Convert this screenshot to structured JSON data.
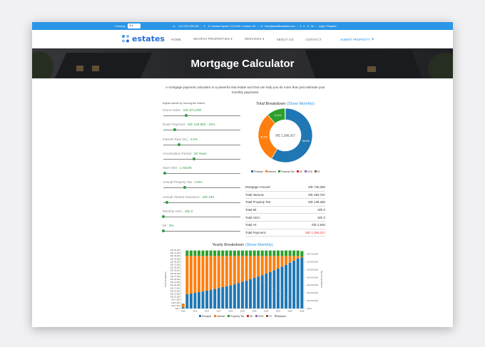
{
  "topbar": {
    "currency_label": "Currency",
    "currency_value": "$",
    "phone": "+44 7073 258 326",
    "address": "11 Canada Square, E14 5HX, London, UK",
    "email": "hello@startfiloestates.com",
    "login": "Login / Register"
  },
  "nav": {
    "logo": "estates",
    "items": [
      "HOME",
      "SEARCH PROPERTIES ▾",
      "SERVICES ▾",
      "ABOUT US",
      "CONTACT"
    ],
    "submit": "SUBMIT PROPERTY"
  },
  "hero": {
    "title": "Mortgage Calculator"
  },
  "intro": "A mortgage payment calculator is a powerful real estate tool that can help you do more than just estimate your monthly payments.",
  "sliders": {
    "heading": "Adjust values by moving the sliders",
    "items": [
      {
        "label": "Home Value",
        "value": "S/E 871,000",
        "level": 0.3
      },
      {
        "label": "Down Payment",
        "value": "S/E 130,650 - 15%",
        "level": 0.15
      },
      {
        "label": "Interest Rate (%)",
        "value": "4.5%",
        "level": 0.2
      },
      {
        "label": "Amortization Period",
        "value": "30 Years",
        "level": 0.4
      },
      {
        "label": "Start After",
        "value": "1 Month",
        "level": 0.02
      },
      {
        "label": "Annual Property Tax",
        "value": "0.8%",
        "level": 0.28
      },
      {
        "label": "Annual Hazard Insurance",
        "value": "S/E 240",
        "level": 0.05
      },
      {
        "label": "Monthly HOA",
        "value": "S/E 0",
        "level": 0.0
      },
      {
        "label": "MI",
        "value": "0%",
        "level": 0.0
      }
    ]
  },
  "total_breakdown": {
    "title": "Total Breakdown",
    "toggle": "(Show Monthly)",
    "center": "S/E 1,266,317",
    "slices": [
      {
        "name": "Principal",
        "pct": 58.5,
        "color": "#1f77b4",
        "label": "58.5%"
      },
      {
        "name": "Interest",
        "pct": 30.3,
        "color": "#ff7f0e",
        "label": "30.3%"
      },
      {
        "name": "Property Tax",
        "pct": 11.0,
        "color": "#2ca02c",
        "label": "11.0%"
      },
      {
        "name": "MI",
        "pct": 0.1,
        "color": "#d62728",
        "label": ""
      },
      {
        "name": "HOA",
        "pct": 0.05,
        "color": "#9467bd",
        "label": ""
      },
      {
        "name": "HI",
        "pct": 0.05,
        "color": "#8c564b",
        "label": ""
      }
    ],
    "legend": [
      "Principal",
      "Interest",
      "Property Tax",
      "MI",
      "HOA",
      "HI"
    ]
  },
  "summary": [
    {
      "label": "Mortgage Amount:",
      "value": "S/E 740,350"
    },
    {
      "label": "Total Interest:",
      "value": "S/E 383,767"
    },
    {
      "label": "Total Property Tax:",
      "value": "S/E 139,360"
    },
    {
      "label": "Total MI:",
      "value": "S/E 0"
    },
    {
      "label": "Total HOA:",
      "value": "S/E 0"
    },
    {
      "label": "Total HI:",
      "value": "S/E 2,840"
    },
    {
      "label": "Total Payment:",
      "value": "S/E 1,266,317"
    }
  ],
  "yearly": {
    "title": "Yearly Breakdown",
    "toggle": "(Show Monthly)"
  },
  "chart_data": {
    "type": "bar",
    "title": "Yearly Breakdown",
    "ylabel": "Yearly Breakdown",
    "y2label": "Remaining Balance",
    "x_ticks": [
      "2018",
      "2021",
      "2024",
      "2027",
      "2030",
      "2033",
      "2036",
      "2039",
      "2042",
      "2045",
      "2048"
    ],
    "y_ticks": [
      "S/E 0",
      "S/E 2,500",
      "S/E 5,000",
      "S/E 7,500",
      "S/E 10,000",
      "S/E 12,500",
      "S/E 15,000",
      "S/E 17,500",
      "S/E 20,000",
      "S/E 22,500",
      "S/E 25,000",
      "S/E 27,500",
      "S/E 30,000",
      "S/E 32,500",
      "S/E 35,000",
      "S/E 37,500",
      "S/E 40,000",
      "S/E 42,500",
      "S/E 45,000",
      "S/E 47,500",
      "S/E 50,000"
    ],
    "y2_ticks": [
      "S/E 0",
      "S/E 100,000",
      "S/E 200,000",
      "S/E 300,000",
      "S/E 400,000",
      "S/E 500,000",
      "S/E 600,000",
      "S/E 700,000"
    ],
    "ylim": [
      0,
      50000
    ],
    "y2lim": [
      0,
      750000
    ],
    "legend": [
      "Principal",
      "Interest",
      "Property Tax",
      "MI",
      "HOA",
      "HI",
      "Balance"
    ],
    "colors": {
      "principal": "#1f77b4",
      "interest": "#ff7f0e",
      "tax": "#2ca02c",
      "balance": "#aaaaaa"
    },
    "years": [
      2018,
      2019,
      2020,
      2021,
      2022,
      2023,
      2024,
      2025,
      2026,
      2027,
      2028,
      2029,
      2030,
      2031,
      2032,
      2033,
      2034,
      2035,
      2036,
      2037,
      2038,
      2039,
      2040,
      2041,
      2042,
      2043,
      2044,
      2045,
      2046,
      2047,
      2048
    ],
    "principal": [
      1100,
      12200,
      12800,
      13400,
      14000,
      14600,
      15300,
      16000,
      16700,
      17500,
      18300,
      19100,
      20000,
      20900,
      21900,
      22900,
      23900,
      25000,
      26200,
      27400,
      28600,
      29900,
      31300,
      32700,
      34200,
      35800,
      37400,
      39200,
      41000,
      42800,
      43600
    ],
    "interest": [
      2700,
      32800,
      32200,
      31600,
      31000,
      30400,
      29700,
      29000,
      28300,
      27500,
      26700,
      25900,
      25000,
      24100,
      23100,
      22100,
      21100,
      20000,
      18800,
      17600,
      16400,
      15100,
      13700,
      12300,
      10800,
      9200,
      7600,
      5800,
      4000,
      2200,
      900
    ],
    "tax": [
      400,
      4650,
      4650,
      4650,
      4650,
      4650,
      4650,
      4650,
      4650,
      4650,
      4650,
      4650,
      4650,
      4650,
      4650,
      4650,
      4650,
      4650,
      4650,
      4650,
      4650,
      4650,
      4650,
      4650,
      4650,
      4650,
      4650,
      4650,
      4650,
      4650,
      4650
    ],
    "balance": [
      739250,
      727050,
      714250,
      700850,
      686850,
      672250,
      656950,
      640950,
      624250,
      606750,
      588450,
      569350,
      549350,
      528450,
      506550,
      483650,
      459750,
      434750,
      408550,
      381150,
      352550,
      322650,
      291350,
      258650,
      224450,
      188650,
      151250,
      112050,
      71050,
      28250,
      0
    ]
  }
}
